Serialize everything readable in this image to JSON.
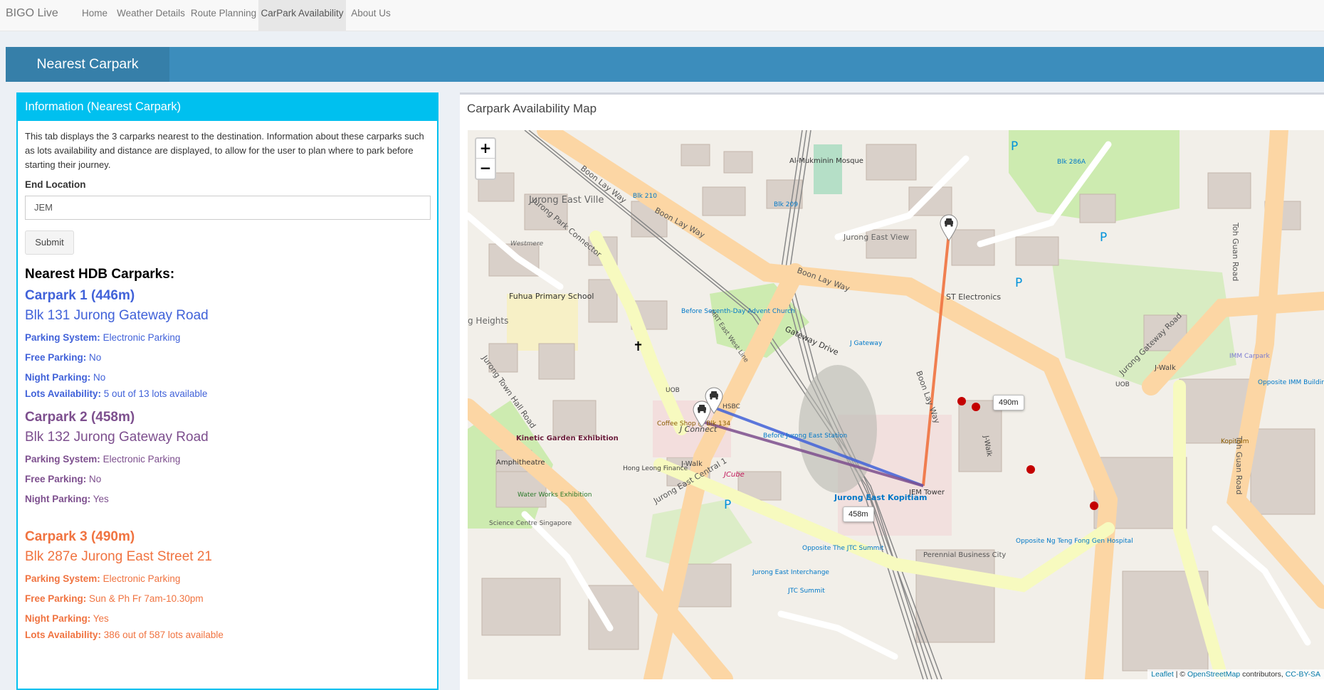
{
  "navbar": {
    "brand": "BIGO Live",
    "items": [
      "Home",
      "Weather Details",
      "Route Planning",
      "CarPark Availability",
      "About Us"
    ],
    "active_index": 3
  },
  "header": {
    "title": "Nearest Carpark"
  },
  "info": {
    "title": "Information (Nearest Carpark)",
    "description": "This tab displays the 3 carparks nearest to the destination. Information about these carparks such as lots availability and distance are displayed, to allow for the user to plan where to park before starting their journey.",
    "end_location_label": "End Location",
    "end_location_value": "JEM",
    "submit_label": "Submit",
    "nearest_title": "Nearest HDB Carparks:",
    "carparks": [
      {
        "title": "Carpark 1 (446m)",
        "address": "Blk 131 Jurong Gateway Road",
        "parking_system_label": "Parking System:",
        "parking_system": "Electronic Parking",
        "free_parking_label": "Free Parking:",
        "free_parking": "No",
        "night_parking_label": "Night Parking:",
        "night_parking": "No",
        "lots_label": "Lots Availability:",
        "lots": "5 out of 13 lots available",
        "color": "#4162d9"
      },
      {
        "title": "Carpark 2 (458m)",
        "address": "Blk 132 Jurong Gateway Road",
        "parking_system_label": "Parking System:",
        "parking_system": "Electronic Parking",
        "free_parking_label": "Free Parking:",
        "free_parking": "No",
        "night_parking_label": "Night Parking:",
        "night_parking": "Yes",
        "color": "#7d4f8e"
      },
      {
        "title": "Carpark 3 (490m)",
        "address": "Blk 287e Jurong East Street 21",
        "parking_system_label": "Parking System:",
        "parking_system": "Electronic Parking",
        "free_parking_label": "Free Parking:",
        "free_parking": "Sun & Ph Fr 7am-10.30pm",
        "night_parking_label": "Night Parking:",
        "night_parking": "Yes",
        "lots_label": "Lots Availability:",
        "lots": "386 out of 587 lots available",
        "color": "#f07340"
      }
    ]
  },
  "map": {
    "title": "Carpark Availability Map",
    "zoom_in": "+",
    "zoom_out": "−",
    "attribution_leaflet": "Leaflet",
    "attribution_sep": " | © ",
    "attribution_osm": "OpenStreetMap",
    "attribution_contrib": " contributors, ",
    "attribution_license": "CC-BY-SA",
    "route_labels": [
      "490m",
      "458m"
    ],
    "place_labels": {
      "boon_lay_way_1": "Boon Lay Way",
      "boon_lay_way_2": "Boon Lay Way",
      "boon_lay_way_3": "Boon Lay Way",
      "boon_lay_way_4": "Boon Lay Way",
      "jurong_east_ville": "Jurong East Ville",
      "jurong_east_view": "Jurong East View",
      "fuhua_school": "Fuhua Primary School",
      "westmere": "Westmere",
      "al_mukminin": "Al-Mukminin Mosque",
      "st_electronics": "ST Electronics",
      "toh_guan_road_1": "Toh Guan Road",
      "toh_guan_road_2": "Toh Guan Road",
      "jurong_gateway_road": "Jurong Gateway Road",
      "jurong_town_hall": "Jurong Town Hall Road",
      "kinetic_garden": "Kinetic Garden Exhibition",
      "amphitheatre": "Amphitheatre",
      "water_works": "Water Works Exhibition",
      "science_centre": "Science Centre Singapore",
      "coffee_shop": "Coffee Shop @ Blk 134",
      "j_connect": "J Connect",
      "hsbc": "HSBC",
      "uob_1": "UOB",
      "uob_2": "UOB",
      "hong_leong": "Hong Leong Finance",
      "j_walk_1": "J-Walk",
      "j_walk_2": "J-Walk",
      "j_walk_3": "J-Walk",
      "jcube": "JCube",
      "jurong_east_central": "Jurong East Central 1",
      "before_seventh": "Before Seventh-Day Advent Church",
      "j_gateway": "J Gateway",
      "gateway_drive": "Gateway Drive",
      "jem_tower": "JEM Tower",
      "jurong_east_kopitiam": "Jurong East Kopitiam",
      "opposite_jtc": "Opposite The JTC Summit",
      "jurong_east_interchange": "Jurong East Interchange",
      "jtc_summit": "JTC Summit",
      "perennial": "Perennial Business City",
      "opposite_ng_teng": "Opposite Ng Teng Fong Gen Hospital",
      "kopitiam": "Kopitiam",
      "imm_carpark": "IMM Carpark",
      "opposite_imm": "Opposite IMM Building",
      "heights": "g Heights",
      "jurong_park_connector": "Jurong Park Connector",
      "mrt_line": "MRT East West Line",
      "blk_210": "Blk 210",
      "blk_209": "Blk 209",
      "blk_286a": "Blk 286A",
      "before_jurong_east_station": "Before Jurong East Station"
    }
  }
}
